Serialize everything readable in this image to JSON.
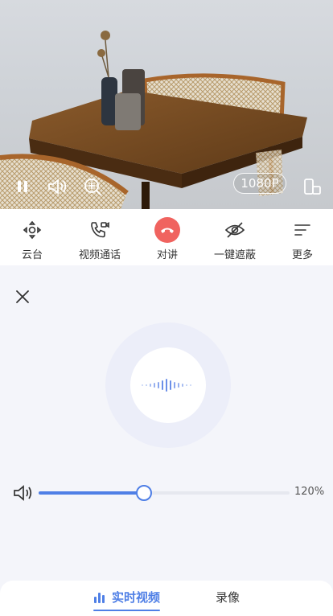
{
  "video": {
    "resolution": "1080P",
    "icons": [
      "pause-icon",
      "speaker-icon",
      "zoom-in-icon",
      "rotate-screen-icon"
    ]
  },
  "toolbar": {
    "items": [
      {
        "label": "云台",
        "icon": "ptz-icon"
      },
      {
        "label": "视频通话",
        "icon": "video-call-icon"
      },
      {
        "label": "对讲",
        "icon": "hang-up-icon"
      },
      {
        "label": "一键遮蔽",
        "icon": "eye-off-icon"
      },
      {
        "label": "更多",
        "icon": "more-icon"
      }
    ],
    "hangup_color": "#f0635f"
  },
  "talk": {
    "volume": {
      "value_percent": 120,
      "label": "120%",
      "slider_fraction": 0.42
    },
    "accent": "#4f7fe6"
  },
  "tabs": [
    {
      "label": "实时视频",
      "active": true
    },
    {
      "label": "录像",
      "active": false
    }
  ]
}
